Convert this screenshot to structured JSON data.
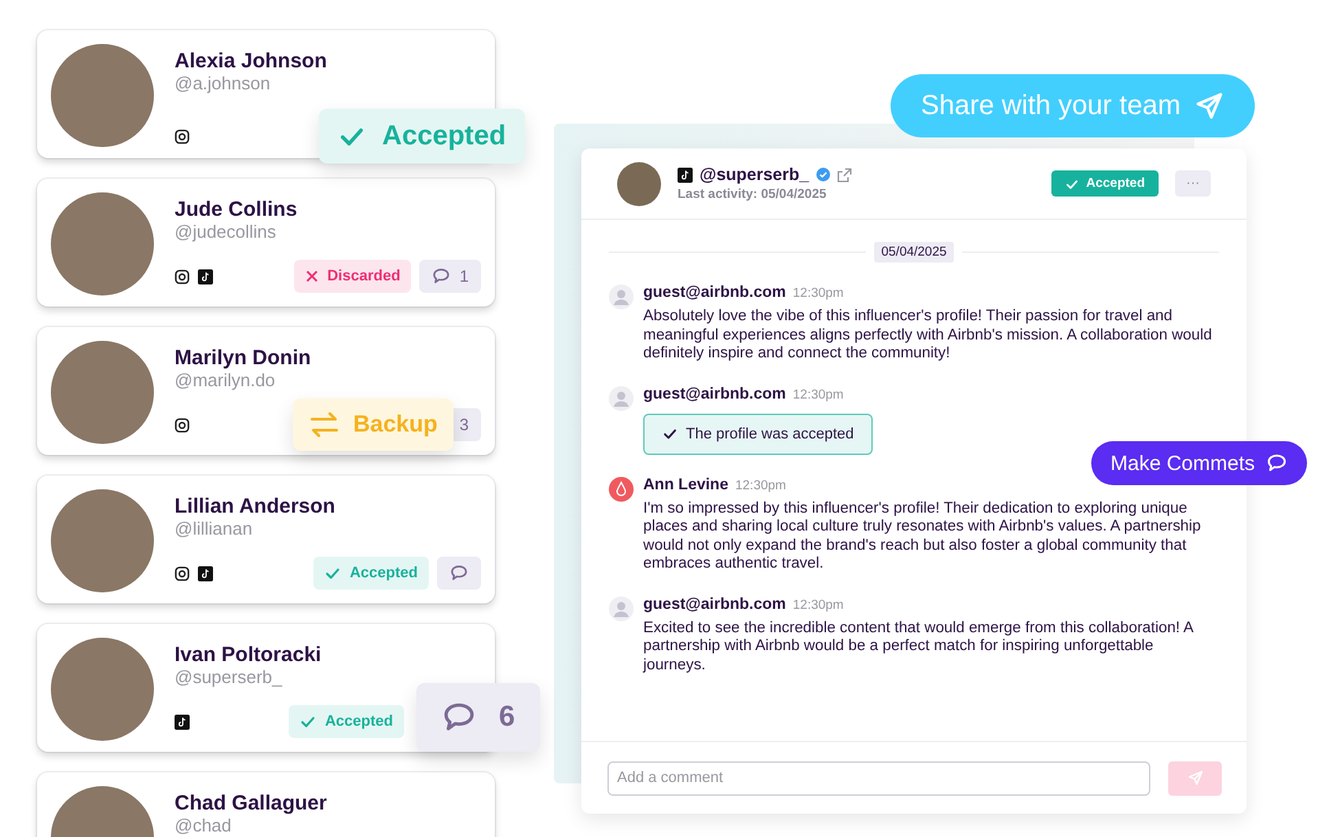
{
  "cards": [
    {
      "name": "Alexia Johnson",
      "handle": "@a.johnson",
      "instagram": true,
      "tiktok": false
    },
    {
      "name": "Jude Collins",
      "handle": "@judecollins",
      "instagram": true,
      "tiktok": true,
      "status": {
        "kind": "discarded",
        "label": "Discarded"
      },
      "comment_button": true,
      "comment_count": "1"
    },
    {
      "name": "Marilyn Donin",
      "handle": "@marilyn.do",
      "instagram": true,
      "tiktok": false,
      "comment_button": true,
      "comment_count": "3"
    },
    {
      "name": "Lillian Anderson",
      "handle": "@lillianan",
      "instagram": true,
      "tiktok": true,
      "status": {
        "kind": "accepted",
        "label": "Accepted"
      },
      "comment_button": true
    },
    {
      "name": "Ivan Poltoracki",
      "handle": "@superserb_",
      "instagram": false,
      "tiktok": true,
      "status": {
        "kind": "accepted",
        "label": "Accepted"
      }
    },
    {
      "name": "Chad Gallaguer",
      "handle": "@chad"
    }
  ],
  "floating_badges": [
    {
      "kind": "accepted",
      "label": "Accepted"
    },
    {
      "kind": "backup",
      "label": "Backup"
    },
    {
      "kind": "comments",
      "label": "6"
    }
  ],
  "share_button": {
    "label": "Share with your team"
  },
  "make_comments_button": {
    "label": "Make Commets"
  },
  "chat": {
    "header": {
      "handle": "@superserb_",
      "verified": true,
      "last_activity": "Last activity: 05/04/2025",
      "status": "Accepted",
      "more_label": "···"
    },
    "date_divider": "05/04/2025",
    "messages": [
      {
        "kind": "text",
        "brand_avatar": false,
        "author": "guest@airbnb.com",
        "time": "12:30pm",
        "text": "Absolutely love the vibe of this influencer's profile! Their passion for travel and meaningful experiences aligns perfectly with Airbnb's mission. A collaboration would definitely inspire and connect the community!"
      },
      {
        "kind": "note",
        "brand_avatar": false,
        "author": "guest@airbnb.com",
        "time": "12:30pm",
        "text": "The profile was accepted"
      },
      {
        "kind": "text",
        "brand_avatar": true,
        "author": "Ann Levine",
        "time": "12:30pm",
        "text": "I'm so impressed by this influencer's profile! Their dedication to exploring unique places and sharing local culture truly resonates with Airbnb's values. A partnership would not only expand the brand's reach but also foster a global community that embraces authentic travel."
      },
      {
        "kind": "text",
        "brand_avatar": false,
        "author": "guest@airbnb.com",
        "time": "12:30pm",
        "text": "Excited to see the incredible content that would emerge from this collaboration! A partnership with Airbnb would be a perfect match for inspiring unforgettable journeys."
      }
    ],
    "composer": {
      "placeholder": "Add a comment"
    }
  }
}
